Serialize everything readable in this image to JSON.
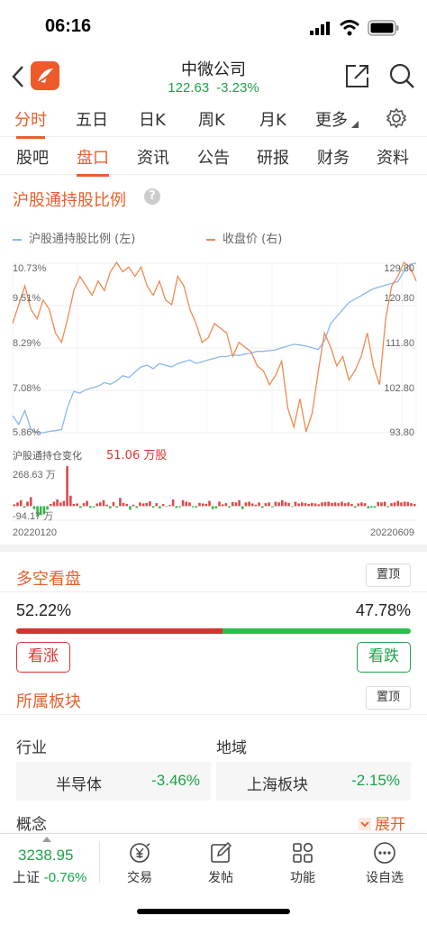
{
  "status_bar": {
    "time": "06:16"
  },
  "header": {
    "title": "中微公司",
    "price": "122.63",
    "change": "-3.23%"
  },
  "tabs_primary": [
    "分时",
    "五日",
    "日K",
    "周K",
    "月K",
    "更多"
  ],
  "tabs_secondary": [
    "股吧",
    "盘口",
    "资讯",
    "公告",
    "研报",
    "财务",
    "资料"
  ],
  "holding_section": {
    "title": "沪股通持股比例",
    "legend_ratio": "沪股通持股比例 (左)",
    "legend_close": "收盘价 (右)",
    "left_ticks": [
      "10.73%",
      "9.51%",
      "8.29%",
      "7.08%",
      "5.86%"
    ],
    "right_ticks": [
      "129.80",
      "120.80",
      "111.80",
      "102.80",
      "93.80"
    ],
    "change_label": "沪股通持仓变化",
    "change_value": "51.06 万股",
    "bar_max": "268.63 万",
    "bar_min": "-94.17 万",
    "start_date": "20220120",
    "end_date": "20220609"
  },
  "sentiment": {
    "title": "多空看盘",
    "pin_label": "置顶",
    "bull_pct": "52.22%",
    "bear_pct": "47.78%",
    "bull_ratio": 0.5222,
    "bull_button": "看涨",
    "bear_button": "看跌"
  },
  "sectors": {
    "title": "所属板块",
    "pin_label": "置顶",
    "industry_label": "行业",
    "region_label": "地域",
    "industry": {
      "name": "半导体",
      "change": "-3.46%"
    },
    "region": {
      "name": "上海板块",
      "change": "-2.15%"
    },
    "concept_label": "概念",
    "expand_label": "展开"
  },
  "bottom_bar": {
    "index_value": "3238.95",
    "index_name": "上证",
    "index_change": "-0.76%",
    "items": [
      "交易",
      "发帖",
      "功能",
      "设自选"
    ]
  },
  "colors": {
    "accent": "#e8602c",
    "up": "#d33333",
    "down": "#1aa34a",
    "ratio_line": "#8ab8ec",
    "close_line": "#ef8a50"
  },
  "chart_data": [
    {
      "type": "line",
      "x_start": "20220120",
      "x_end": "20220609",
      "series": [
        {
          "name": "沪股通持股比例 (左)",
          "axis": "left",
          "ylim": [
            5.86,
            10.73
          ],
          "values": [
            6.35,
            6.1,
            6.5,
            5.95,
            5.86,
            5.86,
            5.9,
            5.92,
            5.95,
            6.6,
            7.05,
            7.0,
            7.1,
            7.15,
            7.2,
            7.3,
            7.25,
            7.35,
            7.5,
            7.45,
            7.6,
            7.75,
            7.8,
            7.7,
            7.85,
            7.8,
            7.75,
            7.85,
            7.9,
            7.95,
            7.85,
            7.9,
            7.95,
            8.0,
            8.05,
            8.05,
            8.1,
            8.08,
            8.12,
            8.15,
            8.2,
            8.2,
            8.22,
            8.24,
            8.3,
            8.35,
            8.4,
            8.38,
            8.35,
            8.3,
            8.25,
            8.5,
            9.0,
            9.2,
            9.4,
            9.6,
            9.7,
            9.8,
            9.9,
            10.0,
            10.05,
            10.1,
            10.15,
            10.2,
            10.5,
            10.7,
            10.73
          ]
        },
        {
          "name": "收盘价 (右)",
          "axis": "right",
          "ylim": [
            93.8,
            129.8
          ],
          "values": [
            117,
            121,
            125,
            120,
            118,
            122,
            120,
            115,
            113,
            118,
            124,
            127,
            125,
            123,
            126,
            124,
            128,
            130,
            128,
            129,
            127,
            129,
            125,
            123,
            126,
            122,
            121,
            127,
            125,
            120,
            117,
            113,
            114,
            117,
            116,
            115,
            110,
            113,
            112,
            111,
            108,
            107,
            104,
            106,
            109,
            99,
            95,
            101,
            94,
            98,
            107,
            115,
            112,
            108,
            110,
            105,
            107,
            110,
            115,
            108,
            104,
            118,
            125,
            127,
            130,
            129,
            126
          ]
        }
      ]
    },
    {
      "type": "bar",
      "title": "沪股通持仓变化",
      "ylim": [
        -94.17,
        268.63
      ],
      "values": [
        12,
        25,
        40,
        -10,
        30,
        60,
        -20,
        -70,
        -60,
        -55,
        -25,
        15,
        30,
        45,
        25,
        35,
        268,
        70,
        15,
        18,
        -12,
        20,
        35,
        -12,
        -8,
        18,
        25,
        40,
        10,
        -15,
        28,
        -10,
        55,
        22,
        15,
        -25,
        10,
        -12,
        25,
        18,
        22,
        32,
        -10,
        20,
        -15,
        15,
        -5,
        8,
        45,
        -12,
        -8,
        40,
        30,
        25,
        -8,
        -10,
        22,
        18,
        15,
        35,
        -20,
        -15,
        30,
        12,
        20,
        -10,
        28,
        25,
        40,
        -20,
        25,
        30,
        18,
        10,
        25,
        -12,
        20,
        25,
        -8,
        30,
        25,
        40,
        28,
        22,
        -5,
        30,
        18,
        25,
        20,
        15,
        22,
        18,
        12,
        25,
        28,
        30,
        22,
        25,
        20,
        30,
        20,
        25,
        15,
        -10,
        18,
        25,
        20,
        -15,
        -10,
        -10,
        28,
        25,
        30,
        -8,
        20,
        25,
        35,
        25,
        30,
        28,
        20,
        15
      ]
    }
  ]
}
